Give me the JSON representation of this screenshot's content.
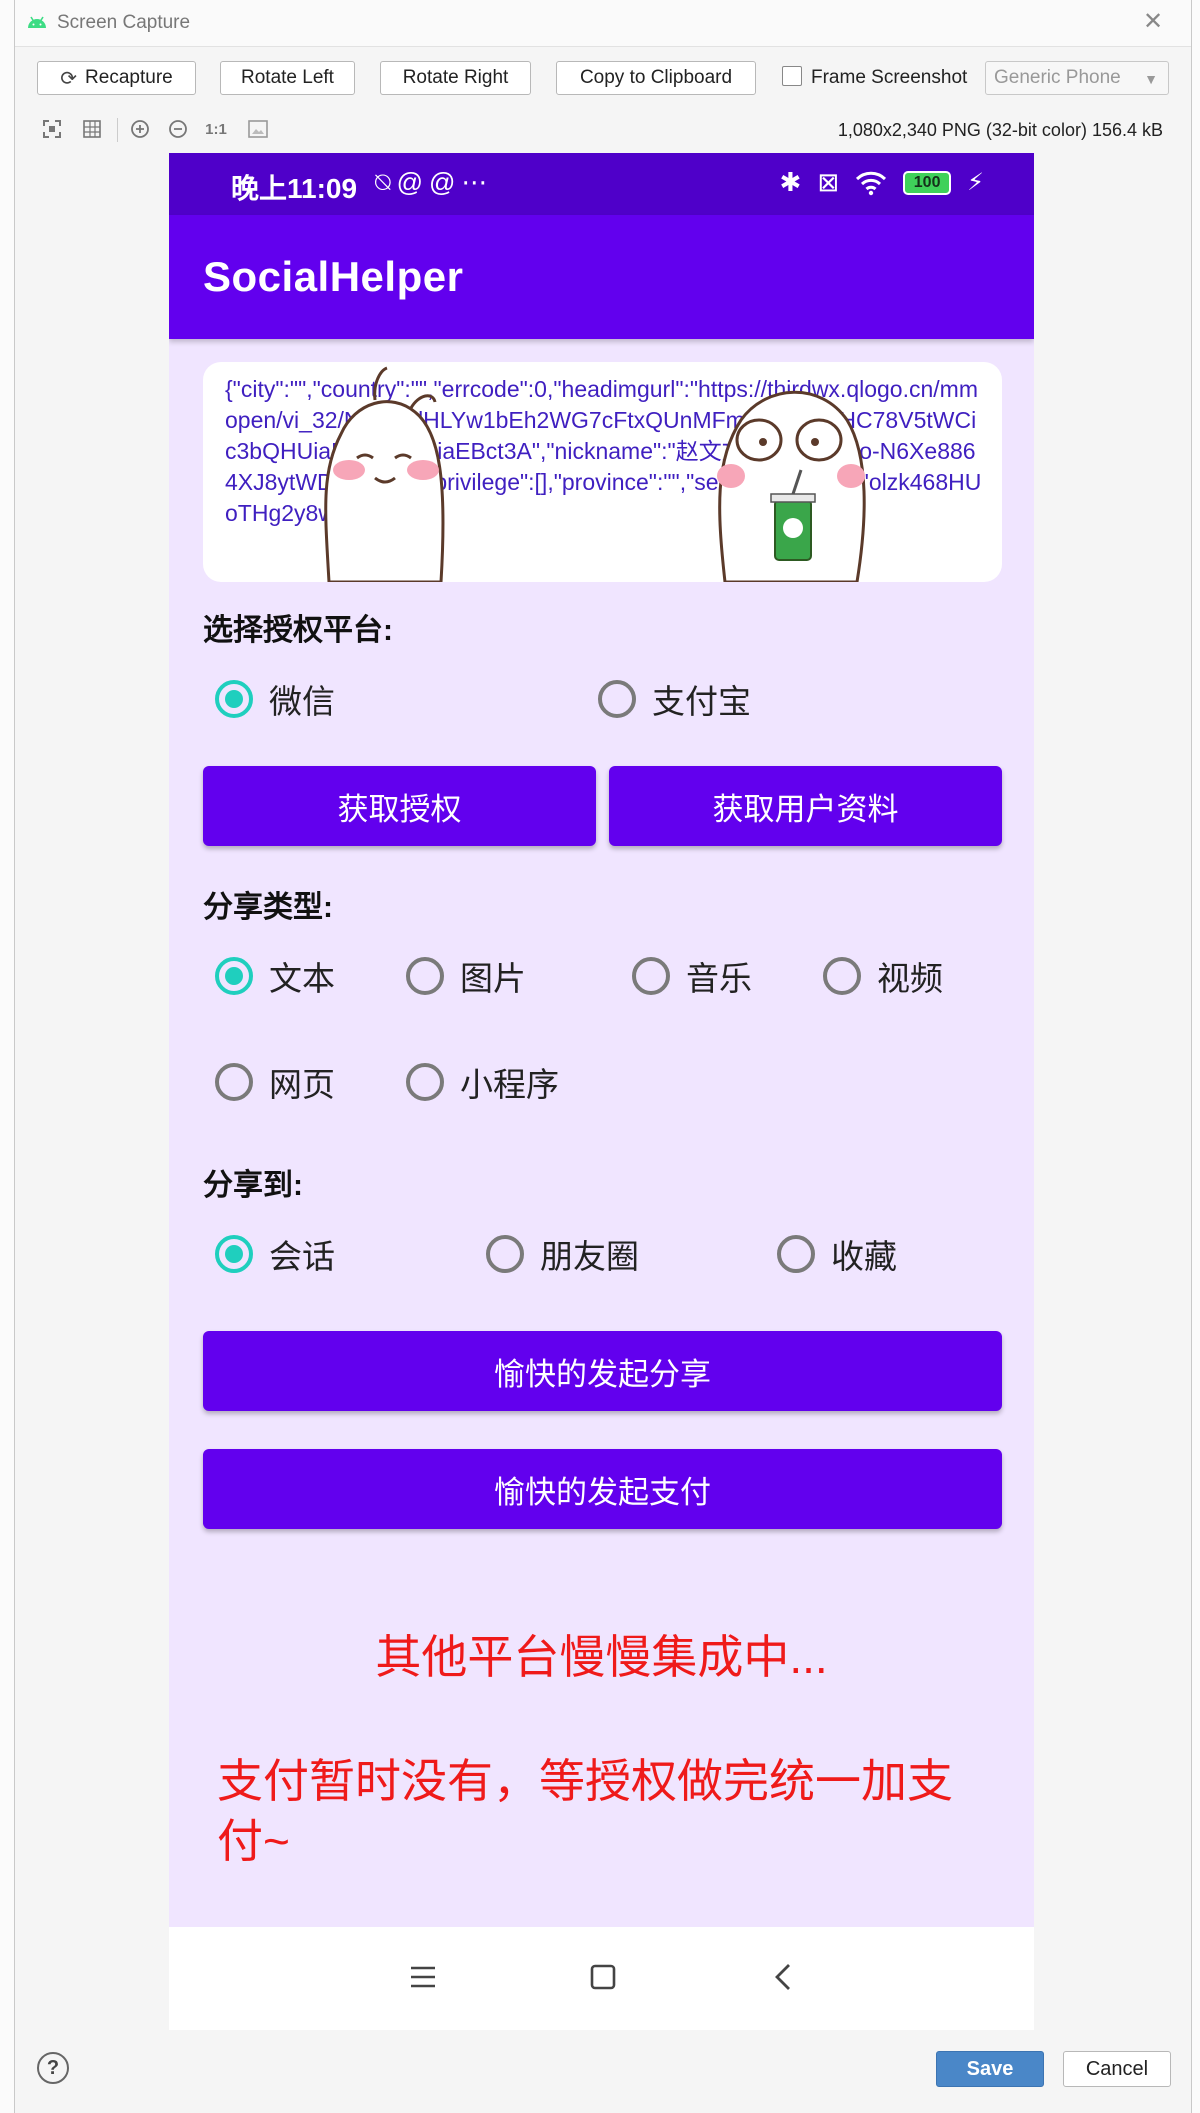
{
  "window": {
    "title": "Screen Capture",
    "close_icon": "close-icon"
  },
  "toolbar": {
    "recapture_label": "Recapture",
    "rotate_left_label": "Rotate Left",
    "rotate_right_label": "Rotate Right",
    "copy_label": "Copy to Clipboard",
    "frame_label": "Frame Screenshot",
    "frame_checked": false,
    "device_select": "Generic Phone"
  },
  "viewbar": {
    "zoom_fit_icon": "fit-screen-icon",
    "grid_icon": "grid-icon",
    "zoom_in_icon": "zoom-in-icon",
    "zoom_out_icon": "zoom-out-icon",
    "actual_size_label": "1:1",
    "image_icon": "image-icon",
    "file_info": "1,080x2,340 PNG (32-bit color) 156.4 kB"
  },
  "phone": {
    "status": {
      "time": "晚上11:09",
      "battery": "100"
    },
    "app_title": "SocialHelper",
    "json_text": "{\"city\":\"\",\"country\":\"\",\"errcode\":0,\"headimgurl\":\"https://thirdwx.qlogo.cn/mmopen/vi_32/NIEHtalHLYw1bEh2WG7cFtxQUnMFmIkE3hQibHC78V5tWCic3bQHUiaBlhib9CdbiaEBct3A\",\"nickname\":\"赵文文\",\"openid\":\"o-N6Xe8864XJ8ytWD_vzSXk\",\"privilege\":[],\"province\":\"\",\"sex\":0,\"unionid\":\"olzk468HUoTHg2y8wF2yU\"}",
    "auth_section_label": "选择授权平台:",
    "auth_options": [
      {
        "label": "微信",
        "checked": true
      },
      {
        "label": "支付宝",
        "checked": false
      }
    ],
    "get_auth_button": "获取授权",
    "get_profile_button": "获取用户资料",
    "share_type_label": "分享类型:",
    "share_types": [
      {
        "label": "文本",
        "checked": true
      },
      {
        "label": "图片",
        "checked": false
      },
      {
        "label": "音乐",
        "checked": false
      },
      {
        "label": "视频",
        "checked": false
      },
      {
        "label": "网页",
        "checked": false
      },
      {
        "label": "小程序",
        "checked": false
      }
    ],
    "share_to_label": "分享到:",
    "share_targets": [
      {
        "label": "会话",
        "checked": true
      },
      {
        "label": "朋友圈",
        "checked": false
      },
      {
        "label": "收藏",
        "checked": false
      }
    ],
    "share_button": "愉快的发起分享",
    "pay_button": "愉快的发起支付",
    "note_1": "其他平台慢慢集成中...",
    "note_2": "支付暂时没有，等授权做完统一加支付~"
  },
  "footer": {
    "help_label": "?",
    "save_label": "Save",
    "cancel_label": "Cancel"
  },
  "colors": {
    "status_bar": "#4f00c9",
    "app_bar": "#6200ee",
    "content_bg": "#f0e5ff",
    "radio_checked": "#1fcfbe",
    "note_red": "#ef1a1a",
    "json_text": "#3f1fc0",
    "save_blue": "#4a87c8"
  }
}
